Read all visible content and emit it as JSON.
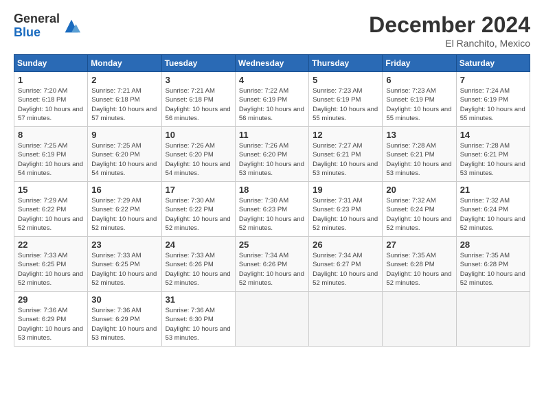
{
  "logo": {
    "general": "General",
    "blue": "Blue"
  },
  "title": "December 2024",
  "location": "El Ranchito, Mexico",
  "days_of_week": [
    "Sunday",
    "Monday",
    "Tuesday",
    "Wednesday",
    "Thursday",
    "Friday",
    "Saturday"
  ],
  "weeks": [
    [
      {
        "day": "1",
        "sunrise": "7:20 AM",
        "sunset": "6:18 PM",
        "daylight": "10 hours and 57 minutes."
      },
      {
        "day": "2",
        "sunrise": "7:21 AM",
        "sunset": "6:18 PM",
        "daylight": "10 hours and 57 minutes."
      },
      {
        "day": "3",
        "sunrise": "7:21 AM",
        "sunset": "6:18 PM",
        "daylight": "10 hours and 56 minutes."
      },
      {
        "day": "4",
        "sunrise": "7:22 AM",
        "sunset": "6:19 PM",
        "daylight": "10 hours and 56 minutes."
      },
      {
        "day": "5",
        "sunrise": "7:23 AM",
        "sunset": "6:19 PM",
        "daylight": "10 hours and 55 minutes."
      },
      {
        "day": "6",
        "sunrise": "7:23 AM",
        "sunset": "6:19 PM",
        "daylight": "10 hours and 55 minutes."
      },
      {
        "day": "7",
        "sunrise": "7:24 AM",
        "sunset": "6:19 PM",
        "daylight": "10 hours and 55 minutes."
      }
    ],
    [
      {
        "day": "8",
        "sunrise": "7:25 AM",
        "sunset": "6:19 PM",
        "daylight": "10 hours and 54 minutes."
      },
      {
        "day": "9",
        "sunrise": "7:25 AM",
        "sunset": "6:20 PM",
        "daylight": "10 hours and 54 minutes."
      },
      {
        "day": "10",
        "sunrise": "7:26 AM",
        "sunset": "6:20 PM",
        "daylight": "10 hours and 54 minutes."
      },
      {
        "day": "11",
        "sunrise": "7:26 AM",
        "sunset": "6:20 PM",
        "daylight": "10 hours and 53 minutes."
      },
      {
        "day": "12",
        "sunrise": "7:27 AM",
        "sunset": "6:21 PM",
        "daylight": "10 hours and 53 minutes."
      },
      {
        "day": "13",
        "sunrise": "7:28 AM",
        "sunset": "6:21 PM",
        "daylight": "10 hours and 53 minutes."
      },
      {
        "day": "14",
        "sunrise": "7:28 AM",
        "sunset": "6:21 PM",
        "daylight": "10 hours and 53 minutes."
      }
    ],
    [
      {
        "day": "15",
        "sunrise": "7:29 AM",
        "sunset": "6:22 PM",
        "daylight": "10 hours and 52 minutes."
      },
      {
        "day": "16",
        "sunrise": "7:29 AM",
        "sunset": "6:22 PM",
        "daylight": "10 hours and 52 minutes."
      },
      {
        "day": "17",
        "sunrise": "7:30 AM",
        "sunset": "6:22 PM",
        "daylight": "10 hours and 52 minutes."
      },
      {
        "day": "18",
        "sunrise": "7:30 AM",
        "sunset": "6:23 PM",
        "daylight": "10 hours and 52 minutes."
      },
      {
        "day": "19",
        "sunrise": "7:31 AM",
        "sunset": "6:23 PM",
        "daylight": "10 hours and 52 minutes."
      },
      {
        "day": "20",
        "sunrise": "7:32 AM",
        "sunset": "6:24 PM",
        "daylight": "10 hours and 52 minutes."
      },
      {
        "day": "21",
        "sunrise": "7:32 AM",
        "sunset": "6:24 PM",
        "daylight": "10 hours and 52 minutes."
      }
    ],
    [
      {
        "day": "22",
        "sunrise": "7:33 AM",
        "sunset": "6:25 PM",
        "daylight": "10 hours and 52 minutes."
      },
      {
        "day": "23",
        "sunrise": "7:33 AM",
        "sunset": "6:25 PM",
        "daylight": "10 hours and 52 minutes."
      },
      {
        "day": "24",
        "sunrise": "7:33 AM",
        "sunset": "6:26 PM",
        "daylight": "10 hours and 52 minutes."
      },
      {
        "day": "25",
        "sunrise": "7:34 AM",
        "sunset": "6:26 PM",
        "daylight": "10 hours and 52 minutes."
      },
      {
        "day": "26",
        "sunrise": "7:34 AM",
        "sunset": "6:27 PM",
        "daylight": "10 hours and 52 minutes."
      },
      {
        "day": "27",
        "sunrise": "7:35 AM",
        "sunset": "6:28 PM",
        "daylight": "10 hours and 52 minutes."
      },
      {
        "day": "28",
        "sunrise": "7:35 AM",
        "sunset": "6:28 PM",
        "daylight": "10 hours and 52 minutes."
      }
    ],
    [
      {
        "day": "29",
        "sunrise": "7:36 AM",
        "sunset": "6:29 PM",
        "daylight": "10 hours and 53 minutes."
      },
      {
        "day": "30",
        "sunrise": "7:36 AM",
        "sunset": "6:29 PM",
        "daylight": "10 hours and 53 minutes."
      },
      {
        "day": "31",
        "sunrise": "7:36 AM",
        "sunset": "6:30 PM",
        "daylight": "10 hours and 53 minutes."
      },
      null,
      null,
      null,
      null
    ]
  ]
}
